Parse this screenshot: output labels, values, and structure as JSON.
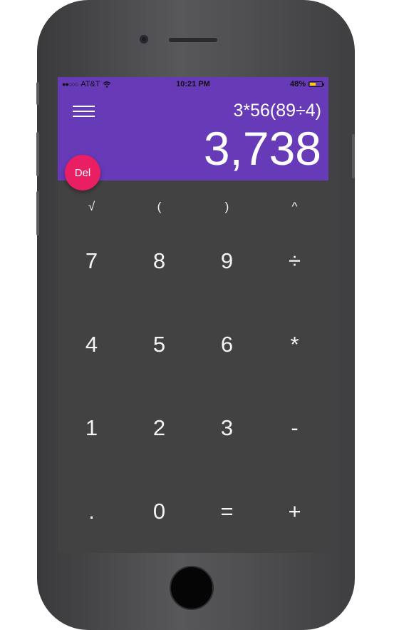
{
  "status_bar": {
    "carrier": "AT&T",
    "time": "10:21 PM",
    "battery": "48%",
    "battery_level": 0.48
  },
  "display": {
    "expression": "3*56(89÷4)",
    "result": "3,738"
  },
  "del_label": "Del",
  "function_keys": [
    "√",
    "(",
    ")",
    "^"
  ],
  "keypad": [
    "7",
    "8",
    "9",
    "÷",
    "4",
    "5",
    "6",
    "*",
    "1",
    "2",
    "3",
    "-",
    ".",
    "0",
    "=",
    "+"
  ],
  "colors": {
    "header": "#673ab7",
    "keypad_bg": "#424242",
    "del_button": "#e91e63"
  },
  "icons": [
    "menu-icon",
    "wifi-icon",
    "signal-dots-icon",
    "battery-icon"
  ]
}
